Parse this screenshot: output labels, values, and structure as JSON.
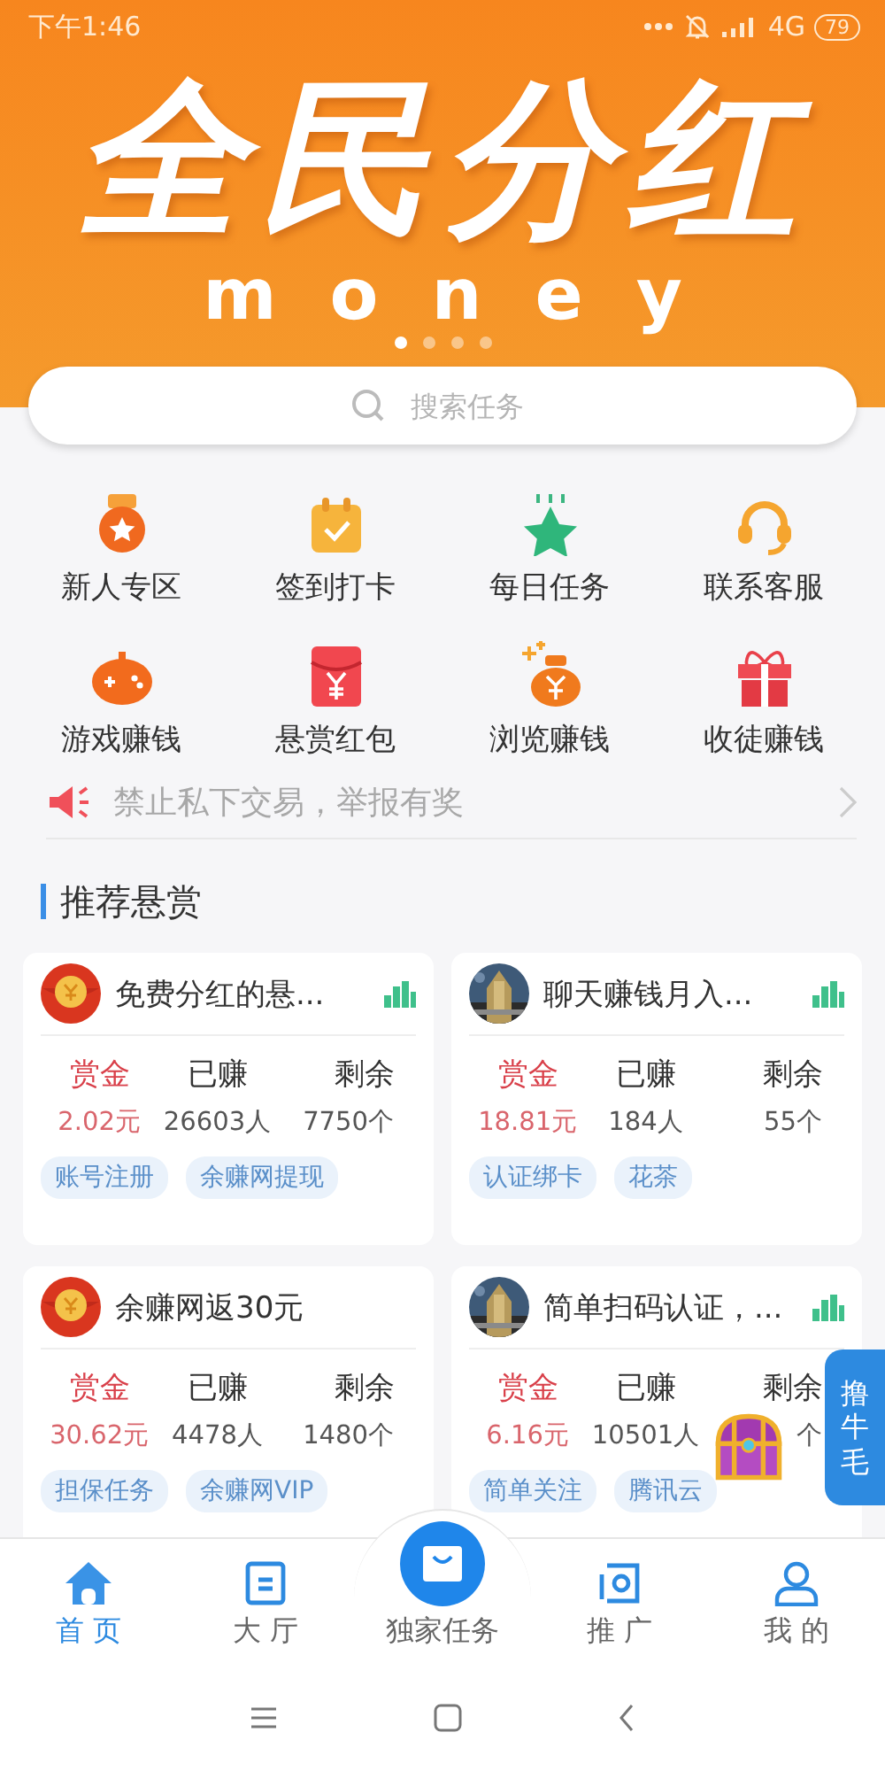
{
  "status_bar": {
    "time": "下午1:46",
    "network": "4G",
    "battery": "79"
  },
  "banner": {
    "title": "全民分红",
    "subtitle": "money",
    "dots": [
      {
        "selected": true
      },
      {
        "selected": false
      },
      {
        "selected": false
      },
      {
        "selected": false
      }
    ]
  },
  "search": {
    "placeholder": "搜索任务"
  },
  "shortcuts": [
    {
      "label": "新人专区"
    },
    {
      "label": "签到打卡"
    },
    {
      "label": "每日任务"
    },
    {
      "label": "联系客服"
    },
    {
      "label": "游戏赚钱"
    },
    {
      "label": "悬赏红包"
    },
    {
      "label": "浏览赚钱"
    },
    {
      "label": "收徒赚钱"
    }
  ],
  "notice": {
    "text": "禁止私下交易，举报有奖"
  },
  "section": {
    "title": "推荐悬赏"
  },
  "cards": [
    {
      "avatar": {
        "kind": "envelope"
      },
      "title": "免费分红的悬...",
      "chart_icon": true,
      "stats": [
        {
          "kind": "reward",
          "label": "赏金",
          "value": "2.02元"
        },
        {
          "kind": "count",
          "label": "已赚",
          "value": "26603人"
        },
        {
          "kind": "count",
          "label": "剩余",
          "value": "7750个"
        }
      ],
      "tags": [
        "账号注册",
        "余赚网提现"
      ]
    },
    {
      "avatar": {
        "kind": "picture"
      },
      "title": "聊天赚钱月入...",
      "chart_icon": true,
      "stats": [
        {
          "kind": "reward",
          "label": "赏金",
          "value": "18.81元"
        },
        {
          "kind": "count",
          "label": "已赚",
          "value": "184人"
        },
        {
          "kind": "count",
          "label": "剩余",
          "value": "55个"
        }
      ],
      "tags": [
        "认证绑卡",
        "花茶"
      ]
    },
    {
      "avatar": {
        "kind": "envelope"
      },
      "title": "余赚网返30元",
      "chart_icon": false,
      "stats": [
        {
          "kind": "reward",
          "label": "赏金",
          "value": "30.62元"
        },
        {
          "kind": "count",
          "label": "已赚",
          "value": "4478人"
        },
        {
          "kind": "count",
          "label": "剩余",
          "value": "1480个"
        }
      ],
      "tags": [
        "担保任务",
        "余赚网VIP"
      ]
    },
    {
      "avatar": {
        "kind": "picture"
      },
      "title": "简单扫码认证，...",
      "chart_icon": true,
      "stats": [
        {
          "kind": "reward",
          "label": "赏金",
          "value": "6.16元"
        },
        {
          "kind": "count",
          "label": "已赚",
          "value": "10501人"
        },
        {
          "kind": "count",
          "label": "剩余",
          "value": "个"
        }
      ],
      "tags": [
        "简单关注",
        "腾讯云"
      ]
    }
  ],
  "float_tab": {
    "label": "撸牛毛"
  },
  "tabbar": [
    {
      "kind": "normal",
      "label": "首 页",
      "selected": true
    },
    {
      "kind": "normal",
      "label": "大 厅",
      "selected": false
    },
    {
      "kind": "center",
      "label": "独家任务",
      "selected": false
    },
    {
      "kind": "normal",
      "label": "推 广",
      "selected": false
    },
    {
      "kind": "normal",
      "label": "我 的",
      "selected": false
    }
  ]
}
